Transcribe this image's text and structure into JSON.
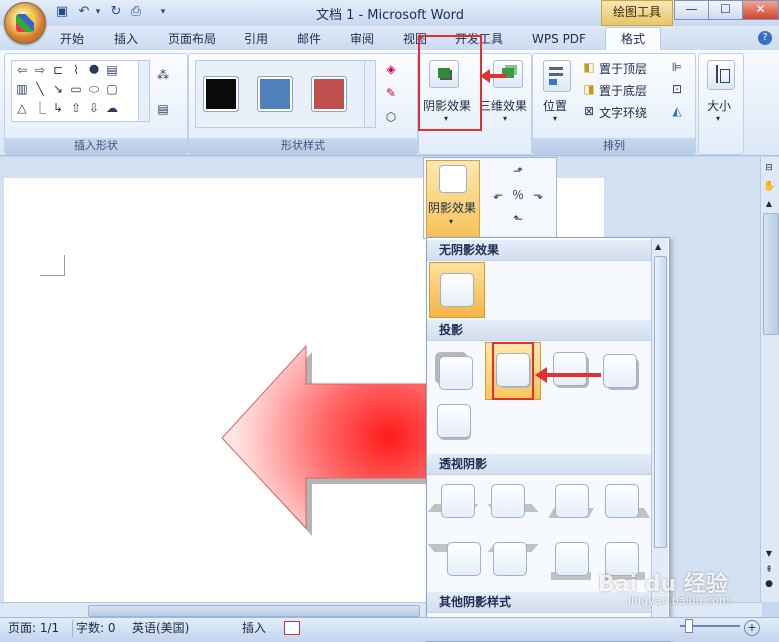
{
  "window": {
    "title": "文档 1 - Microsoft Word",
    "contextual_tab_group": "绘图工具"
  },
  "ribbon": {
    "tabs": [
      "开始",
      "插入",
      "页面布局",
      "引用",
      "邮件",
      "审阅",
      "视图",
      "开发工具",
      "WPS PDF",
      "格式"
    ],
    "active_tab": "格式",
    "groups": {
      "insert_shapes": {
        "label": "插入形状"
      },
      "shape_styles": {
        "label": "形状样式",
        "swatch_colors": [
          "#0a0a0a",
          "#4f81bd",
          "#c0504d"
        ]
      },
      "shadow_effects": {
        "label": "阴影效果"
      },
      "three_d": {
        "label": "三维效果"
      },
      "arrange": {
        "label": "排列",
        "position_label": "位置",
        "bring_front": "置于顶层",
        "send_back": "置于底层",
        "text_wrap": "文字环绕"
      },
      "size": {
        "label": "大小"
      }
    }
  },
  "dropdown": {
    "split_button_label": "阴影效果",
    "sections": {
      "no_shadow": "无阴影效果",
      "drop_shadow": "投影",
      "perspective_shadow": "透视阴影",
      "other_styles": "其他阴影样式"
    }
  },
  "statusbar": {
    "page": "页面: 1/1",
    "words": "字数: 0",
    "language": "英语(美国)",
    "mode": "插入"
  },
  "watermark": {
    "text": "Bai du 经验",
    "sub": "jingyan.baidu.com"
  },
  "colors": {
    "highlight": "#e0302f",
    "arrow_fill": "#ff1a1a",
    "selected_tile": "#f7c65c"
  }
}
